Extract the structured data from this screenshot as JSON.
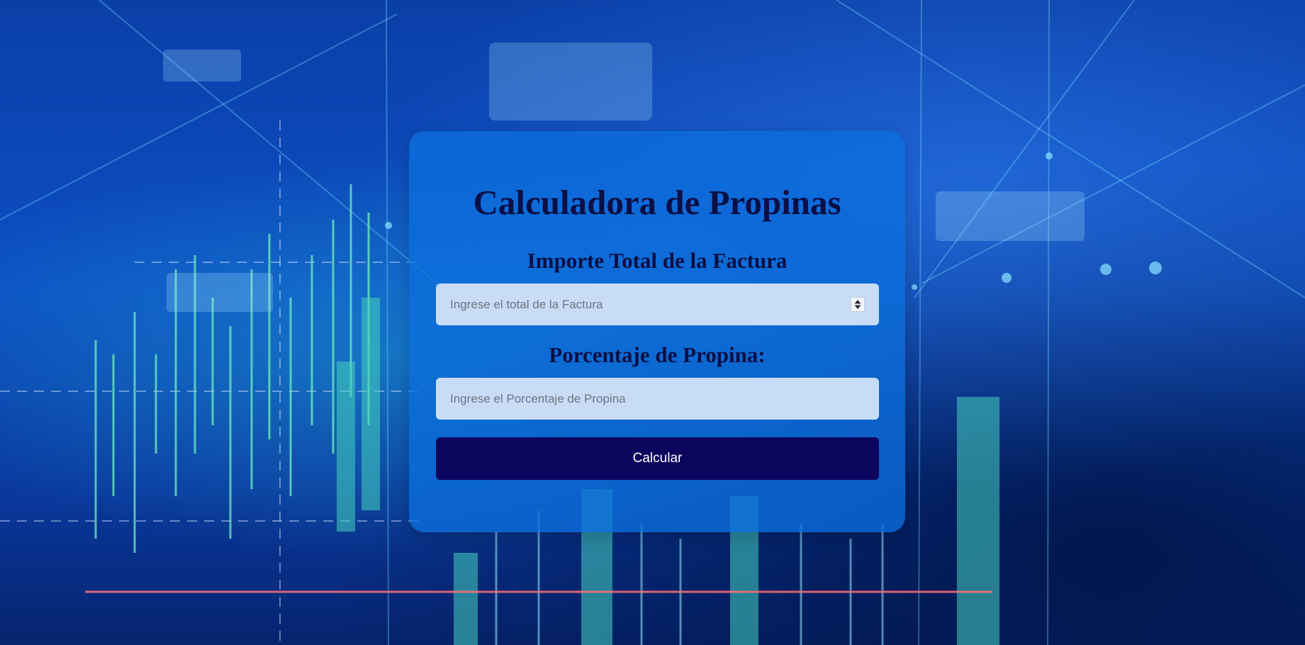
{
  "app": {
    "title": "Calculadora de Propinas"
  },
  "bill": {
    "label": "Importe Total de la Factura",
    "placeholder": "Ingrese el total de la Factura",
    "value": ""
  },
  "tip": {
    "label": "Porcentaje de Propina:",
    "placeholder": "Ingrese el Porcentaje de Propina",
    "value": ""
  },
  "actions": {
    "calculate_label": "Calcular"
  },
  "colors": {
    "card": "#0c6edc",
    "heading": "#0b0f45",
    "input_bg": "#c8dcf6",
    "button_bg": "#0c055e",
    "button_text": "#ffffff"
  },
  "icons": {
    "spinner": "up-down-stepper-icon"
  }
}
